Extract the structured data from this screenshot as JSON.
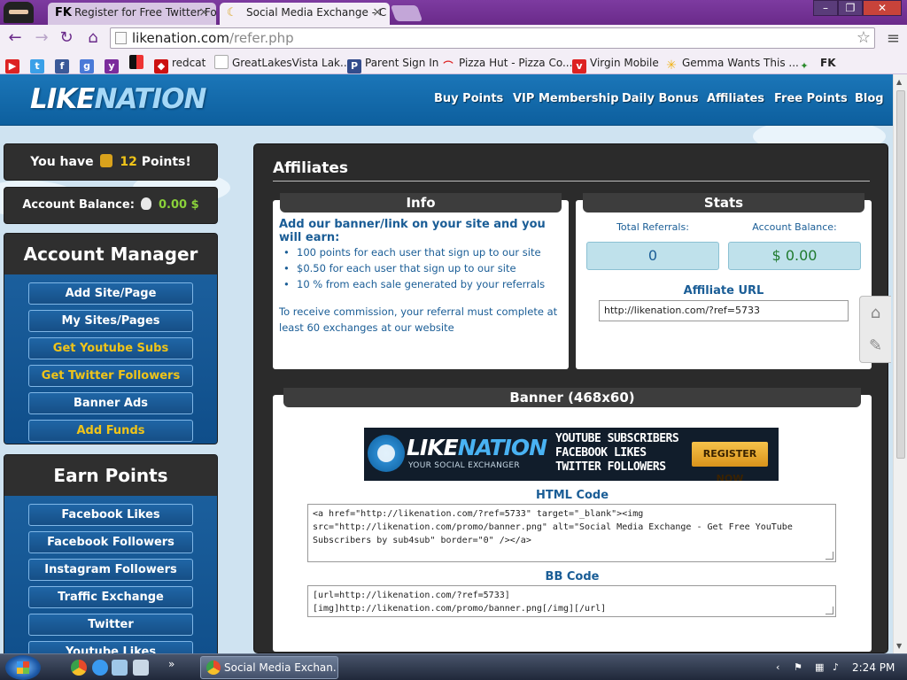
{
  "browser": {
    "tabs": [
      {
        "favicon": "FK",
        "label": "Register for Free Twitter Fo"
      },
      {
        "favicon": "",
        "label": "Social Media Exchange - C"
      }
    ],
    "address": {
      "domain": "likenation.com",
      "path": "/refer.php"
    },
    "bookmarks": [
      {
        "icon": "youtube-icon",
        "label": ""
      },
      {
        "icon": "twitter-icon",
        "label": ""
      },
      {
        "icon": "facebook-icon",
        "label": ""
      },
      {
        "icon": "google-plus-icon",
        "label": ""
      },
      {
        "icon": "yahoo-icon",
        "label": ""
      },
      {
        "icon": "app-icon",
        "label": ""
      },
      {
        "icon": "redcat-icon",
        "label": "redcat"
      },
      {
        "icon": "page-icon",
        "label": "GreatLakesVista Lak..."
      },
      {
        "icon": "p-icon",
        "label": "Parent Sign In"
      },
      {
        "icon": "pizza-icon",
        "label": "Pizza Hut - Pizza Co..."
      },
      {
        "icon": "virgin-icon",
        "label": "Virgin Mobile"
      },
      {
        "icon": "walmart-icon",
        "label": "Gemma Wants This ..."
      },
      {
        "icon": "frog-icon",
        "label": ""
      },
      {
        "icon": "fk-icon",
        "label": "FK"
      }
    ]
  },
  "site": {
    "logo_like": "LIKE",
    "logo_nation": "NATION",
    "nav": [
      "Buy Points",
      "VIP Membership",
      "Daily Bonus",
      "Affiliates",
      "Free Points",
      "Blog"
    ]
  },
  "sidebar": {
    "points_prefix": "You have",
    "points_value": "12",
    "points_suffix": "Points!",
    "balance_label": "Account Balance:",
    "balance_value": "0.00 $",
    "account_manager": {
      "title": "Account Manager",
      "items": [
        {
          "label": "Add Site/Page",
          "highlight": false
        },
        {
          "label": "My Sites/Pages",
          "highlight": false
        },
        {
          "label": "Get Youtube Subs",
          "highlight": true
        },
        {
          "label": "Get Twitter Followers",
          "highlight": true
        },
        {
          "label": "Banner Ads",
          "highlight": false
        },
        {
          "label": "Add Funds",
          "highlight": true
        }
      ]
    },
    "earn_points": {
      "title": "Earn Points",
      "items": [
        "Facebook Likes",
        "Facebook Followers",
        "Instagram Followers",
        "Traffic Exchange",
        "Twitter",
        "Youtube Likes"
      ]
    }
  },
  "main": {
    "title": "Affiliates",
    "info": {
      "heading": "Info",
      "lead": "Add our banner/link on your site and you will earn:",
      "bullets": [
        "100 points for each user that sign up to our site",
        "$0.50 for each user that sign up to our site",
        "10 % from each sale generated by your referrals"
      ],
      "note": "To receive commission, your referral must complete at least 60 exchanges at our website"
    },
    "stats": {
      "heading": "Stats",
      "total_referrals_label": "Total Referrals:",
      "total_referrals_value": "0",
      "account_balance_label": "Account Balance:",
      "account_balance_value": "$ 0.00",
      "affiliate_url_label": "Affiliate URL",
      "affiliate_url_value": "http://likenation.com/?ref=5733"
    },
    "banner": {
      "heading": "Banner (468x60)",
      "logo_like": "LIKE",
      "logo_nation": "NATION",
      "tagline": "YOUR SOCIAL EXCHANGER",
      "lines": [
        "YOUTUBE SUBSCRIBERS",
        "FACEBOOK LIKES",
        "TWITTER FOLLOWERS"
      ],
      "cta": "REGISTER NOW"
    },
    "html_code_label": "HTML Code",
    "html_code": "<a href=\"http://likenation.com/?ref=5733\" target=\"_blank\"><img src=\"http://likenation.com/promo/banner.png\" alt=\"Social Media Exchange - Get Free YouTube Subscribers by sub4sub\" border=\"0\" /></a>",
    "bb_code_label": "BB Code",
    "bb_code": "[url=http://likenation.com/?ref=5733]\n[img]http://likenation.com/promo/banner.png[/img][/url]"
  },
  "taskbar": {
    "task_label": "Social Media Exchan...",
    "time": "2:24 PM"
  },
  "colors": {
    "accent_blue": "#1a5d96",
    "header_blue": "#1b76b8",
    "gold": "#f0c419",
    "green": "#8ad13a",
    "browser_purple": "#6a2a8a"
  }
}
